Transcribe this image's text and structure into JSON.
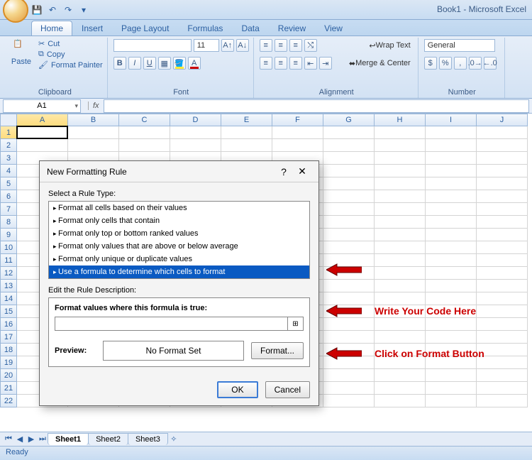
{
  "titlebar": {
    "app_title": "Book1 - Microsoft Excel"
  },
  "tabs": {
    "home": "Home",
    "insert": "Insert",
    "page_layout": "Page Layout",
    "formulas": "Formulas",
    "data": "Data",
    "review": "Review",
    "view": "View"
  },
  "ribbon": {
    "clipboard": {
      "paste": "Paste",
      "cut": "Cut",
      "copy": "Copy",
      "painter": "Format Painter",
      "label": "Clipboard"
    },
    "font": {
      "family_value": "",
      "size_value": "11",
      "label": "Font"
    },
    "alignment": {
      "wrap": "Wrap Text",
      "merge": "Merge & Center",
      "label": "Alignment"
    },
    "number": {
      "format_value": "General",
      "label": "Number"
    }
  },
  "namebox": {
    "value": "A1"
  },
  "formula_bar": {
    "fx": "fx"
  },
  "columns": [
    "A",
    "B",
    "C",
    "D",
    "E",
    "F",
    "G",
    "H",
    "I",
    "J"
  ],
  "rows": [
    "1",
    "2",
    "3",
    "4",
    "5",
    "6",
    "7",
    "8",
    "9",
    "10",
    "11",
    "12",
    "13",
    "14",
    "15",
    "16",
    "17",
    "18",
    "19",
    "20",
    "21",
    "22"
  ],
  "sheets": {
    "s1": "Sheet1",
    "s2": "Sheet2",
    "s3": "Sheet3"
  },
  "status": {
    "ready": "Ready"
  },
  "dialog": {
    "title": "New Formatting Rule",
    "help": "?",
    "close": "✕",
    "select_label": "Select a Rule Type:",
    "rules": [
      "Format all cells based on their values",
      "Format only cells that contain",
      "Format only top or bottom ranked values",
      "Format only values that are above or below average",
      "Format only unique or duplicate values",
      "Use a formula to determine which cells to format"
    ],
    "edit_label": "Edit the Rule Description:",
    "formula_label": "Format values where this formula is true:",
    "formula_value": "",
    "preview_label": "Preview:",
    "no_format": "No Format Set",
    "format_btn": "Format...",
    "ok": "OK",
    "cancel": "Cancel"
  },
  "annotations": {
    "write_code": "Write Your Code Here",
    "click_format": "Click on Format Button"
  }
}
